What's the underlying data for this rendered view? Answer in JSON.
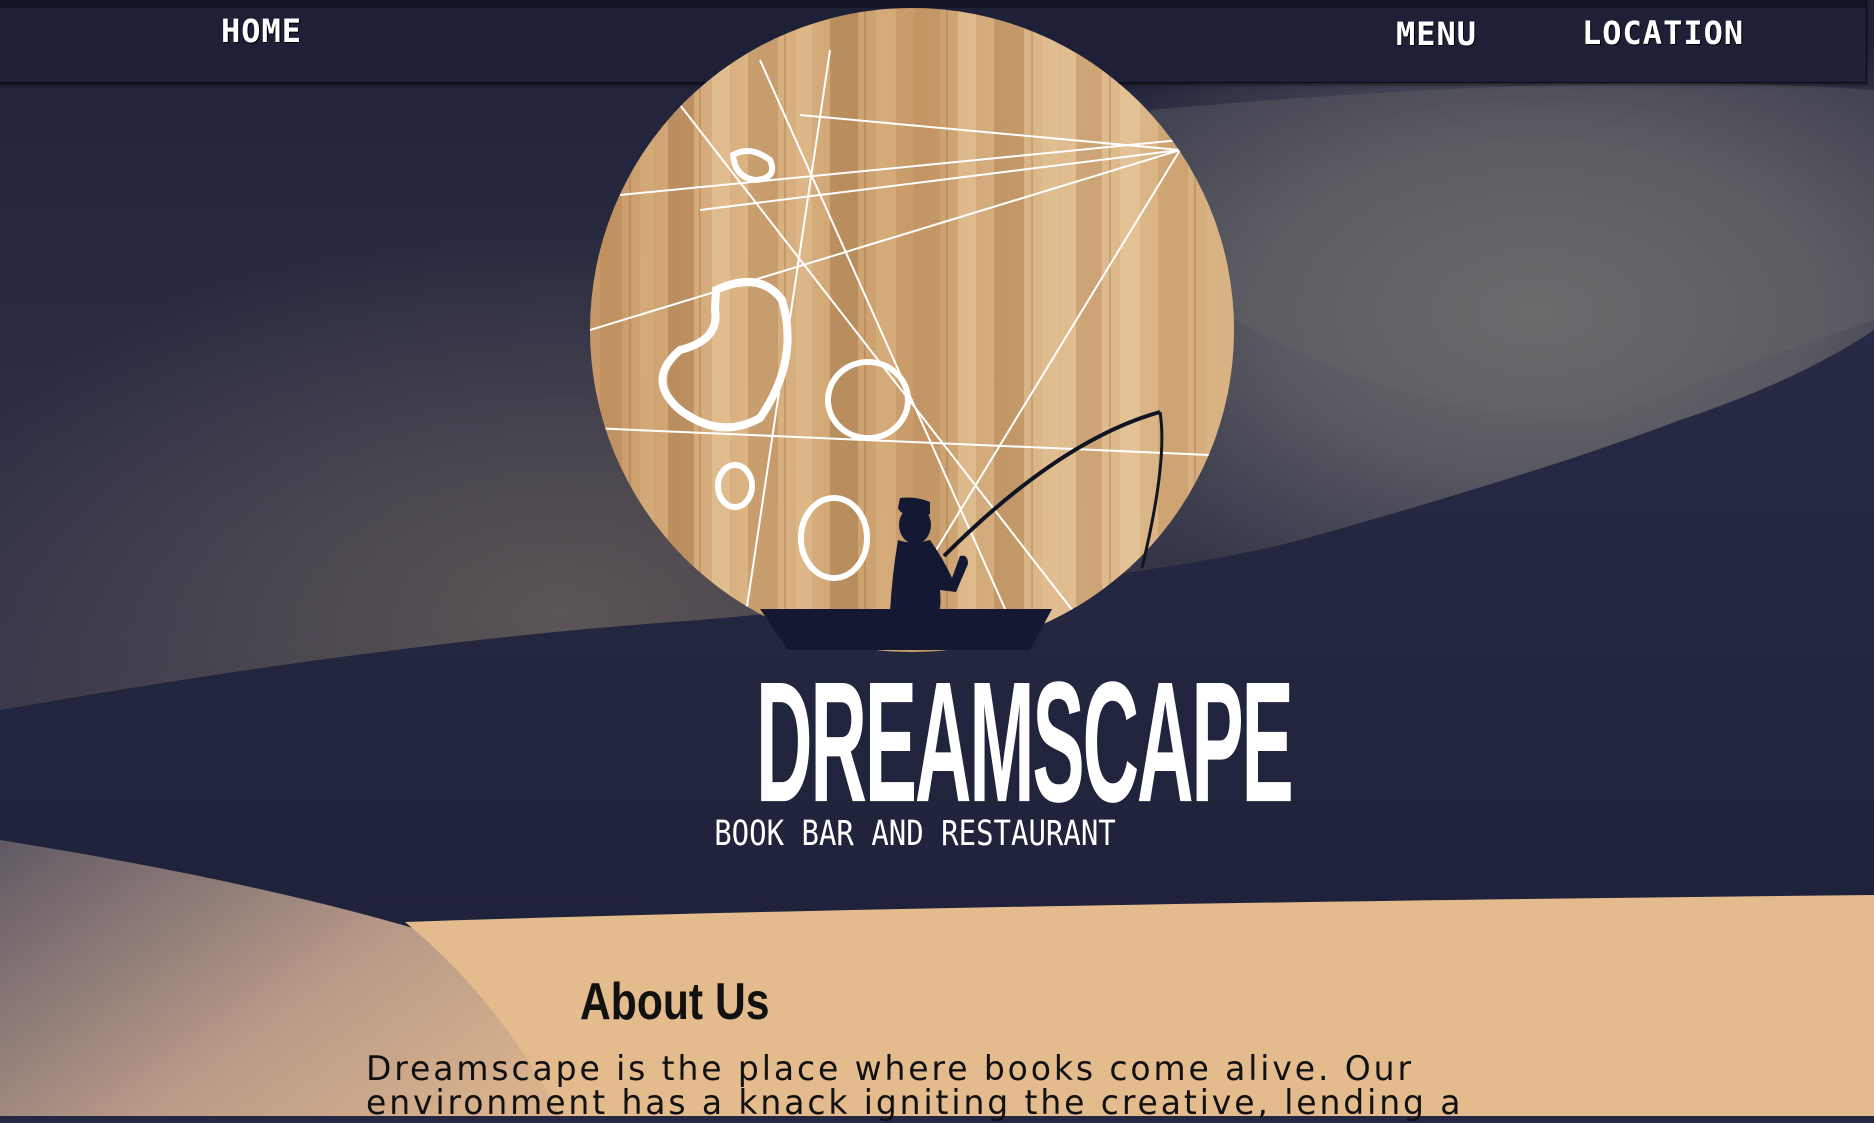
{
  "nav": {
    "home": "HOME",
    "menu": "MENU",
    "location": "LOCATION"
  },
  "logo": {
    "title": "DREAMSCAPE",
    "subtitle": "BOOK BAR AND RESTAURANT"
  },
  "about": {
    "heading": "About Us",
    "body": "Dreamscape is the place where books come alive. Our environment has a knack igniting the creative, lending a"
  },
  "colors": {
    "navbar": "#1d2036",
    "background_navy": "#252843",
    "sand": "#e3bb8c",
    "wood": "#d6ac7a",
    "text_dark": "#111111"
  },
  "icons": [
    "fisherman-silhouette-icon",
    "boat-icon",
    "moon-craters-icon"
  ]
}
